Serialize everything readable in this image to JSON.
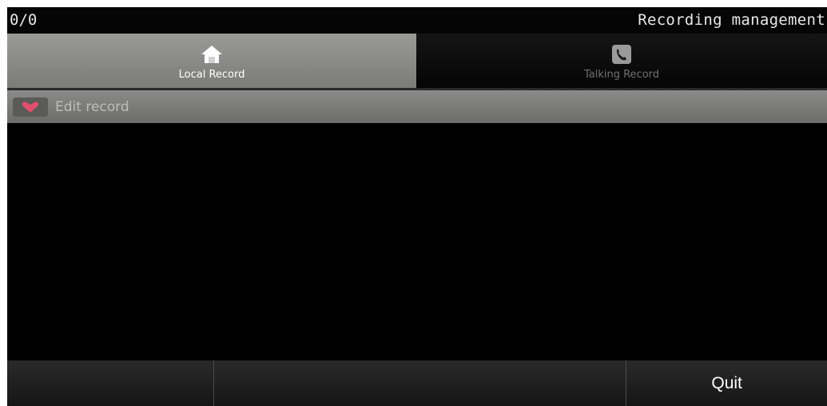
{
  "status_bar": {
    "counter": "0/0",
    "title": "Recording management"
  },
  "tabs": [
    {
      "label": "Local Record",
      "icon": "home-icon",
      "selected": true
    },
    {
      "label": "Talking Record",
      "icon": "phone-icon",
      "selected": false
    }
  ],
  "list": {
    "items": [
      {
        "label": "Edit record",
        "icon": "edit-heart-icon"
      }
    ]
  },
  "bottom_bar": {
    "buttons": [
      "",
      "",
      "Quit"
    ]
  },
  "colors": {
    "selected_tab": "#8c8c8a",
    "unselected_tab": "#0d0d0d",
    "list_item": "#7c7c7a",
    "icon_accent": "#d94a6a",
    "background": "#000000"
  }
}
